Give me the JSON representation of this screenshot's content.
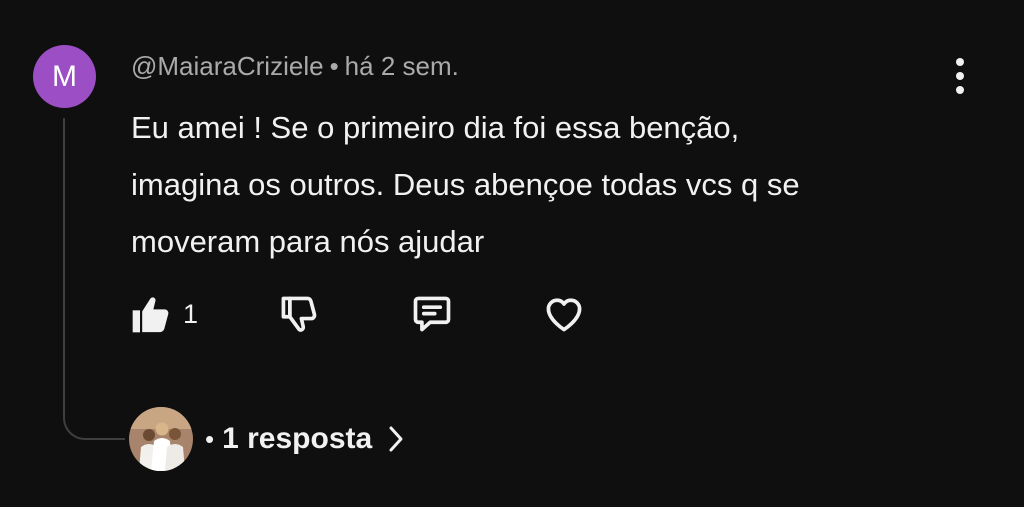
{
  "comment": {
    "author_initial": "M",
    "avatar_color": "#9c4ec4",
    "author": "@MaiaraCriziele",
    "separator": "•",
    "time": "há 2 sem.",
    "lines": [
      "Eu amei ! Se o primeiro dia foi essa benção,",
      "imagina os outros. Deus abençoe todas vcs q se",
      "moveram para nós ajudar"
    ],
    "actions": {
      "like_icon": "thumbs-up-icon",
      "like_count": "1",
      "dislike_icon": "thumbs-down-icon",
      "reply_icon": "comment-icon",
      "heart_icon": "heart-icon"
    },
    "more_icon": "more-vertical-icon",
    "replies": {
      "separator": "•",
      "label": "1 resposta",
      "chevron_icon": "chevron-right-icon"
    }
  },
  "colors": {
    "background": "#0f0f0f",
    "text": "#f1f1f1",
    "secondary_text": "#aaaaaa",
    "thread_line": "#3f3f3f"
  }
}
